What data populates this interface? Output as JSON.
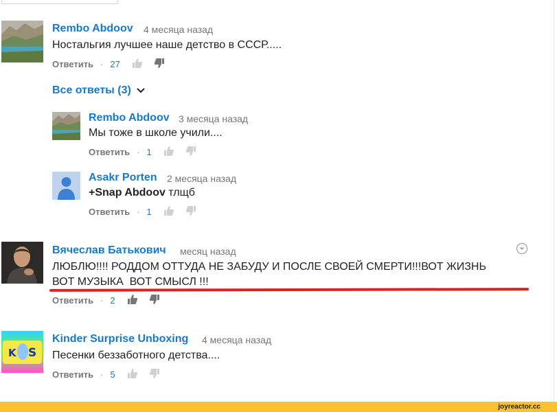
{
  "comments": [
    {
      "author": "Rembo Abdoov",
      "time": "4 месяца назад",
      "text": "Ностальгия лучшее наше детство в СССР.....",
      "reply_label": "Ответить",
      "separator": "·",
      "likes": "27"
    },
    {
      "author": "Вячеслав Батькович",
      "time": "месяц назад",
      "text_line1": "ЛЮБЛЮ!!!! РОДДОМ ОТТУДА НЕ ЗАБУДУ И ПОСЛЕ СВОЕЙ СМЕРТИ!!!ВОТ ЖИЗНЬ",
      "text_line2": "ВОТ МУЗЫКА  ВОТ СМЫСЛ !!!",
      "reply_label": "Ответить",
      "separator": "·",
      "likes": "2"
    },
    {
      "author": "Kinder Surprise Unboxing",
      "time": "4 месяца назад",
      "text": "Песенки беззаботного детства....",
      "reply_label": "Ответить",
      "separator": "·",
      "likes": "5"
    }
  ],
  "view_replies": {
    "label": "Все ответы (3)"
  },
  "replies": [
    {
      "author": "Rembo Abdoov",
      "time": "3 месяца назад",
      "text": "Мы тоже в школе учили....",
      "reply_label": "Ответить",
      "separator": "·",
      "likes": "1"
    },
    {
      "author": "Asakr Porten",
      "time": "2 месяца назад",
      "mention": "+Snap Abdoov",
      "text": " тлщб",
      "reply_label": "Ответить",
      "separator": "·",
      "likes": "1"
    }
  ],
  "kinder_avatar_letters": {
    "k": "K",
    "s": "S"
  },
  "watermark": "joyreactor.cc",
  "colors": {
    "link": "#167ac6",
    "muted": "#767676",
    "annotation_underline": "#e02020",
    "footer_bar": "#fcc22b"
  },
  "icons": [
    "thumb-up-icon",
    "thumb-down-icon",
    "chevron-down-icon",
    "action-menu-icon",
    "default-avatar-icon"
  ]
}
